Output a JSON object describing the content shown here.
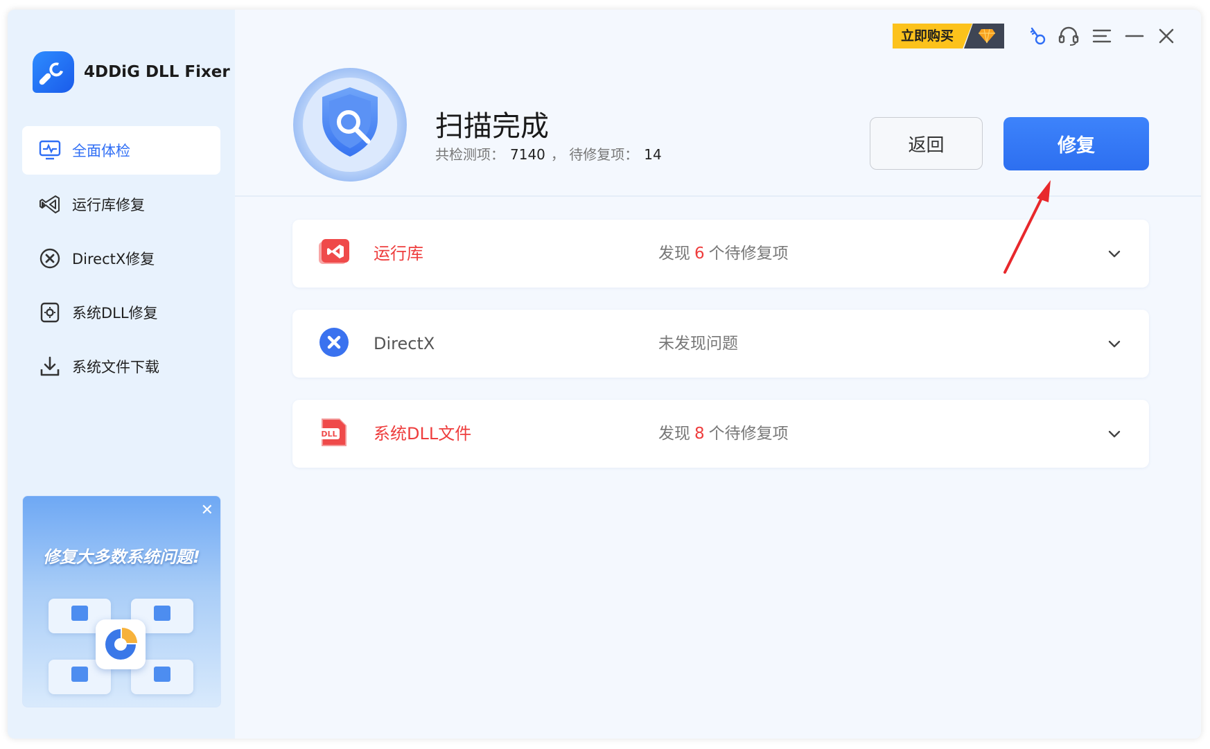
{
  "app": {
    "name": "4DDiG DLL Fixer"
  },
  "toolbar": {
    "buy_label": "立即购买",
    "icons": [
      "key-icon",
      "headset-icon",
      "menu-icon",
      "minimize-icon",
      "close-icon"
    ]
  },
  "sidebar": {
    "items": [
      {
        "label": "全面体检",
        "icon": "health-monitor-icon",
        "active": true
      },
      {
        "label": "运行库修复",
        "icon": "runtime-icon",
        "active": false
      },
      {
        "label": "DirectX修复",
        "icon": "directx-icon",
        "active": false
      },
      {
        "label": "系统DLL修复",
        "icon": "system-dll-icon",
        "active": false
      },
      {
        "label": "系统文件下载",
        "icon": "download-icon",
        "active": false
      }
    ],
    "promo": {
      "title": "修复大多数系统问题!"
    }
  },
  "header": {
    "title": "扫描完成",
    "checked_label": "共检测项：",
    "checked_count": "7140",
    "separator": "，",
    "pending_label": "待修复项：",
    "pending_count": "14",
    "back_label": "返回",
    "fix_label": "修复"
  },
  "results": [
    {
      "name": "运行库",
      "status_prefix": "发现",
      "count": "6",
      "status_suffix": "个待修复项",
      "has_issue": true,
      "icon": "runtime-red-icon"
    },
    {
      "name": "DirectX",
      "status_text": "未发现问题",
      "has_issue": false,
      "icon": "directx-blue-icon"
    },
    {
      "name": "系统DLL文件",
      "status_prefix": "发现",
      "count": "8",
      "status_suffix": "个待修复项",
      "has_issue": true,
      "icon": "dll-red-icon"
    }
  ],
  "colors": {
    "accent": "#2f6ef5",
    "fix_button": "#3a7cf8",
    "issue_red": "#ee3d3d",
    "buy_yellow": "#fcc21b",
    "sidebar_bg": "#e8f2fd",
    "annotation_arrow": "#e8282c"
  }
}
